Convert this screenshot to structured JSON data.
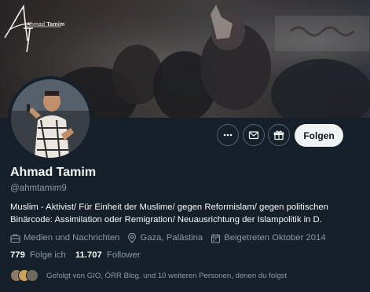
{
  "banner": {
    "logo_word_1": "Ahmad",
    "logo_word_2": "Tamim"
  },
  "actions": {
    "more_icon": "more-horizontal-icon",
    "message_icon": "envelope-icon",
    "subscribe_icon": "gift-icon",
    "follow_label": "Folgen"
  },
  "profile": {
    "display_name": "Ahmad Tamim",
    "handle": "@ahmtamim9",
    "bio": "Muslim - Aktivist/ Für Einheit der Muslime/ gegen Reformislam/ gegen politischen Binärcode: Assimilation oder Remigration/ Neuausrichtung der Islampolitik in D."
  },
  "meta": {
    "category": "Medien und Nachrichten",
    "location": "Gaza, Palästina",
    "joined": "Beigetreten Oktober 2014"
  },
  "counts": {
    "following_value": "779",
    "following_label": "Folge ich",
    "followers_value": "11.707",
    "followers_label": "Follower"
  },
  "followed_by": {
    "text": "Gefolgt von GIO, ÖRR Blog. und 10 weiteren Personen, denen du folgst"
  }
}
